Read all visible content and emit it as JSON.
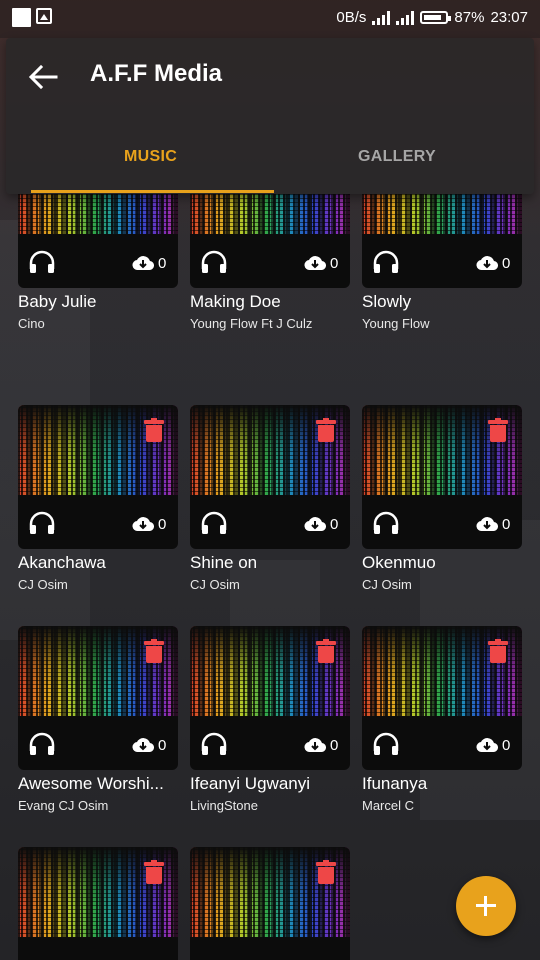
{
  "status_bar": {
    "speed": "0B/s",
    "battery": "87%",
    "time": "23:07"
  },
  "header": {
    "title": "A.F.F Media",
    "tabs": [
      {
        "label": "MUSIC",
        "active": true
      },
      {
        "label": "GALLERY",
        "active": false
      }
    ]
  },
  "colors": {
    "accent": "#e8a21c",
    "delete": "#ee4747",
    "inactive_tab": "#a6a6a6"
  },
  "songs": [
    {
      "title": "Baby Julie",
      "artist": "Cino",
      "downloads": "0"
    },
    {
      "title": "Making Doe",
      "artist": "Young Flow Ft J Culz",
      "downloads": "0"
    },
    {
      "title": "Slowly",
      "artist": "Young Flow",
      "downloads": "0"
    },
    {
      "title": "Akanchawa",
      "artist": "CJ Osim",
      "downloads": "0"
    },
    {
      "title": "Shine on",
      "artist": "CJ Osim",
      "downloads": "0"
    },
    {
      "title": "Okenmuo",
      "artist": "CJ Osim",
      "downloads": "0"
    },
    {
      "title": "Awesome Worshi...",
      "artist": "Evang CJ Osim",
      "downloads": "0"
    },
    {
      "title": "Ifeanyi Ugwanyi",
      "artist": "LivingStone",
      "downloads": "0"
    },
    {
      "title": "Ifunanya",
      "artist": "Marcel C",
      "downloads": "0"
    }
  ],
  "icons": {
    "back": "arrow-left-icon",
    "delete": "trash-icon",
    "listen": "headphones-icon",
    "download": "cloud-download-icon",
    "add": "plus-icon"
  }
}
